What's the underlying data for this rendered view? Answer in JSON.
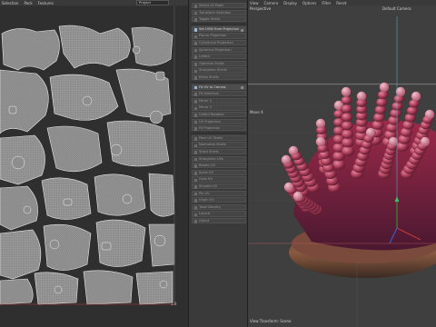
{
  "uv_editor": {
    "menu": [
      "Selection",
      "Pack",
      "Features"
    ],
    "dropdown_value": "Project",
    "coord_label": "1.0"
  },
  "tool_panel": {
    "items": [
      {
        "label": "Select All Pools",
        "active": false
      },
      {
        "label": "Transform Selection",
        "active": false
      },
      {
        "label": "Toggle Shells",
        "active": false
      },
      {
        "label": "Set UVW from Projection",
        "active": true
      },
      {
        "label": "Planar Projection",
        "active": false
      },
      {
        "label": "Cylindrical Projection",
        "active": false
      },
      {
        "label": "Spherical Projection",
        "active": false
      },
      {
        "label": "Unfold",
        "active": false
      },
      {
        "label": "Optimize Shells",
        "active": false
      },
      {
        "label": "Straighten Shells",
        "active": false
      },
      {
        "label": "Relax Shells",
        "active": false
      },
      {
        "label": "Fit UV to Canvas",
        "active": true
      },
      {
        "label": "Fit Selection",
        "active": false
      },
      {
        "label": "Mirror U",
        "active": false
      },
      {
        "label": "Mirror V",
        "active": false
      },
      {
        "label": "Unfold Rotation",
        "active": false
      },
      {
        "label": "UV Projection",
        "active": false
      },
      {
        "label": "Fit Projection",
        "active": false
      },
      {
        "label": "Pack UV Shells",
        "active": false
      },
      {
        "label": "Normalize Shells",
        "active": false
      },
      {
        "label": "Stack Shells",
        "active": false
      },
      {
        "label": "Straighten UVs",
        "active": false
      },
      {
        "label": "Rotate UV",
        "active": false
      },
      {
        "label": "Scale UV",
        "active": false
      },
      {
        "label": "Grab UV",
        "active": false
      },
      {
        "label": "Smooth UV",
        "active": false
      },
      {
        "label": "Pin UV",
        "active": false
      },
      {
        "label": "Unpin UV",
        "active": false
      },
      {
        "label": "Texel Density",
        "active": false
      },
      {
        "label": "Layout",
        "active": false
      },
      {
        "label": "Orient",
        "active": false
      }
    ]
  },
  "viewport": {
    "menu": [
      "View",
      "Camera",
      "Display",
      "Options",
      "Filter",
      "Reset"
    ],
    "perspective_label": "Perspective",
    "camera_label": "Default Camera",
    "axis_label": "Move X",
    "footer_label": "View Transform: Scene"
  }
}
